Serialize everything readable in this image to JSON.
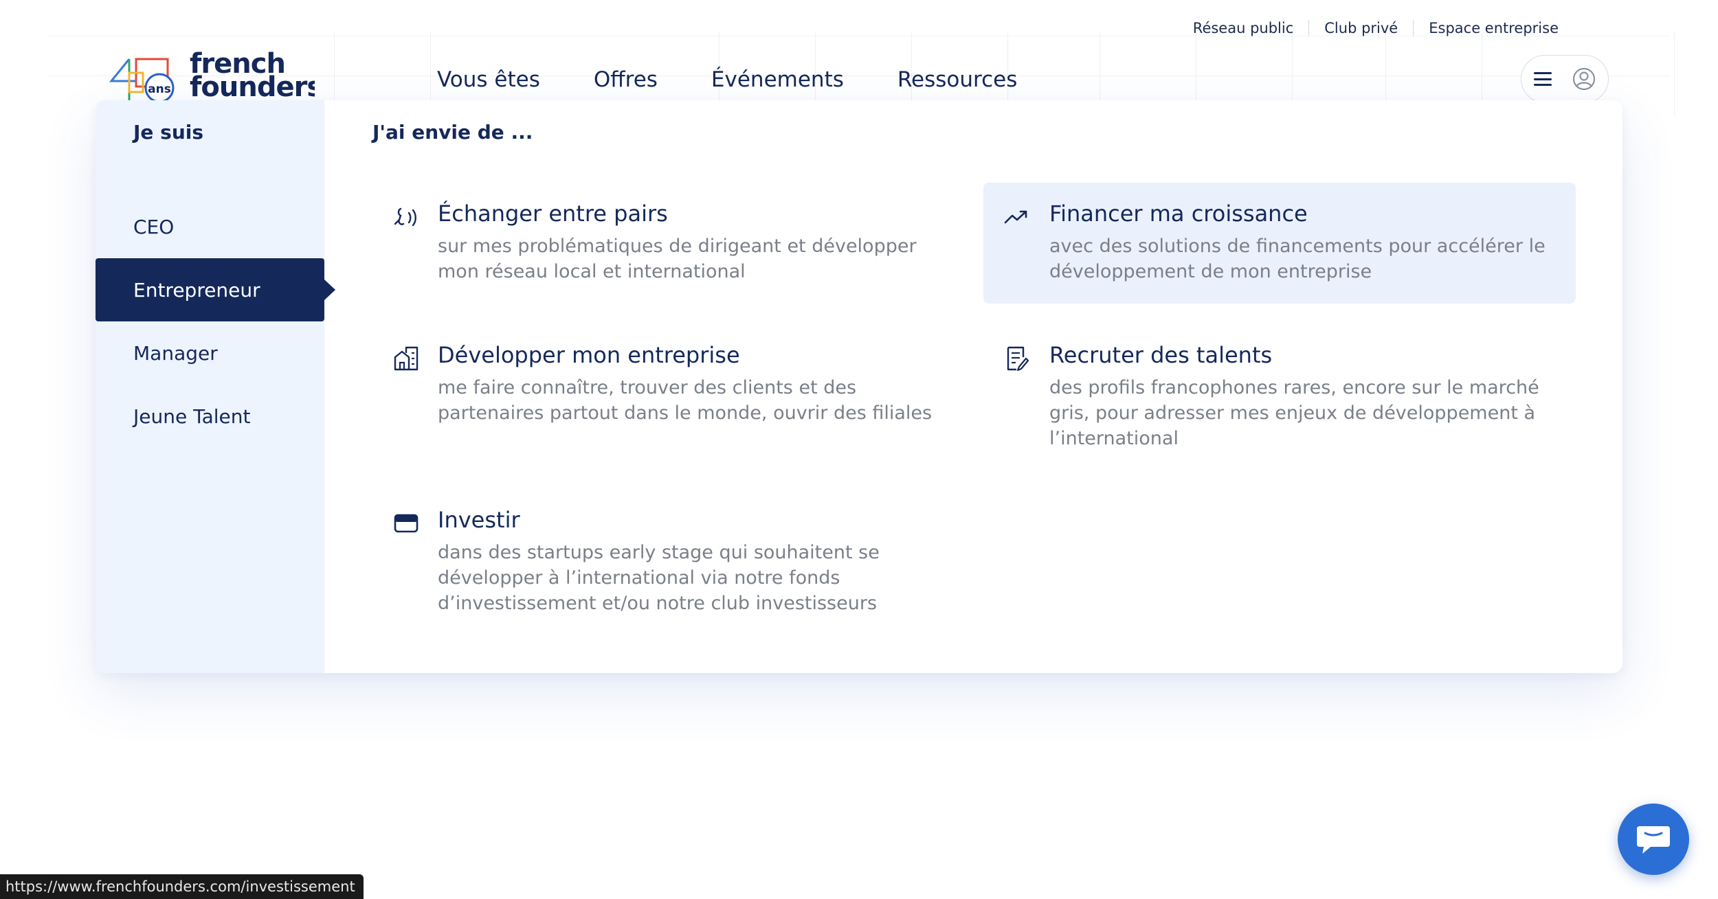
{
  "top_links": [
    "Réseau public",
    "Club privé",
    "Espace entreprise"
  ],
  "logo": {
    "text_line1": "french",
    "text_line2": "founders",
    "badge": "ans"
  },
  "main_nav": [
    "Vous êtes",
    "Offres",
    "Événements",
    "Ressources"
  ],
  "header_icons": {
    "menu": "hamburger-menu-icon",
    "user": "user-circle-icon"
  },
  "sidebar": {
    "heading": "Je suis",
    "items": [
      {
        "label": "CEO",
        "active": false
      },
      {
        "label": "Entrepreneur",
        "active": true
      },
      {
        "label": "Manager",
        "active": false
      },
      {
        "label": "Jeune Talent",
        "active": false
      }
    ]
  },
  "content": {
    "heading": "J'ai envie de ...",
    "cards": [
      {
        "icon": "conversation-icon",
        "title": "Échanger entre pairs",
        "description": "sur mes problématiques de dirigeant et développer mon réseau local et international",
        "highlighted": false
      },
      {
        "icon": "trending-up-icon",
        "title": "Financer ma croissance",
        "description": "avec des solutions de financements pour accélérer le développement de mon entreprise",
        "highlighted": true
      },
      {
        "icon": "buildings-icon",
        "title": "Développer mon entreprise",
        "description": "me faire connaître, trouver des clients et des partenaires partout dans le monde, ouvrir des filiales",
        "highlighted": false
      },
      {
        "icon": "document-edit-icon",
        "title": "Recruter des talents",
        "description": "des profils francophones rares, encore sur le marché gris, pour adresser mes enjeux de développement à l’international",
        "highlighted": false
      },
      {
        "icon": "wallet-icon",
        "title": "Investir",
        "description": "dans des startups early stage qui souhaitent se développer à l’international via notre fonds d’investissement et/ou notre club investisseurs",
        "highlighted": false
      }
    ]
  },
  "status_bar": {
    "url": "https://www.frenchfounders.com/investissement"
  },
  "chat": {
    "icon": "chat-bubble-icon"
  },
  "colors": {
    "navy": "#14285a",
    "sidebar_bg": "#eef4fe",
    "highlight_bg": "#eaf1fd",
    "chat_blue": "#2b6fd6",
    "desc_gray": "#7a7f88"
  }
}
